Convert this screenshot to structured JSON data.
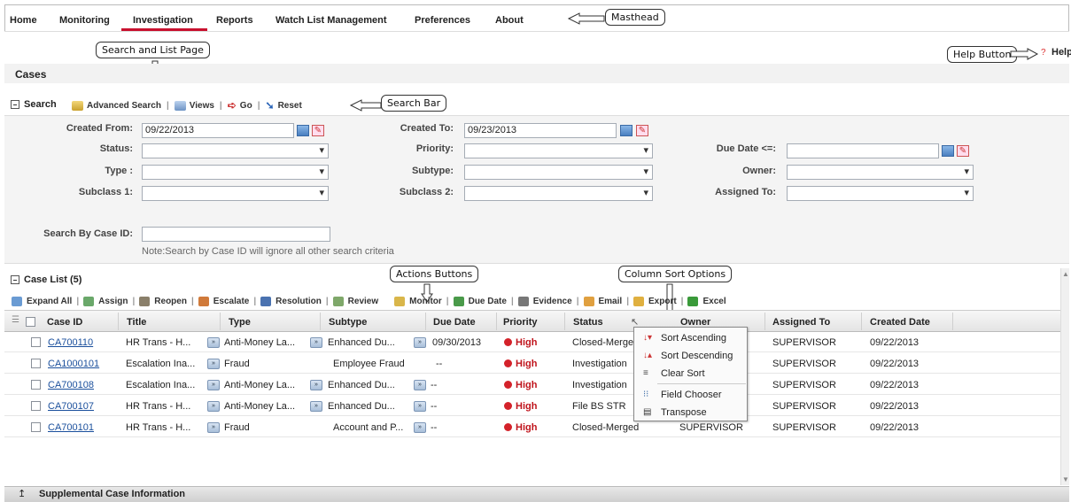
{
  "masthead": {
    "tabs": [
      "Home",
      "Monitoring",
      "Investigation",
      "Reports",
      "Watch List Management",
      "Preferences",
      "About"
    ],
    "active_tab": "Investigation"
  },
  "callouts": {
    "masthead": "Masthead",
    "search_list_page": "Search and List Page",
    "help_button": "Help Button",
    "search_bar": "Search Bar",
    "actions_buttons": "Actions Buttons",
    "column_sort_options": "Column Sort Options"
  },
  "page": {
    "title": "Cases",
    "help": "Help"
  },
  "search": {
    "title": "Search",
    "tools": {
      "advanced": "Advanced Search",
      "views": "Views",
      "go": "Go",
      "reset": "Reset"
    },
    "fields": {
      "created_from": {
        "label": "Created From:",
        "value": "09/22/2013"
      },
      "created_to": {
        "label": "Created To:",
        "value": "09/23/2013"
      },
      "status": {
        "label": "Status:",
        "value": ""
      },
      "priority": {
        "label": "Priority:",
        "value": ""
      },
      "due_date": {
        "label": "Due Date <=:",
        "value": ""
      },
      "type": {
        "label": "Type :",
        "value": ""
      },
      "subtype": {
        "label": "Subtype:",
        "value": ""
      },
      "owner": {
        "label": "Owner:",
        "value": ""
      },
      "subclass1": {
        "label": "Subclass 1:",
        "value": ""
      },
      "subclass2": {
        "label": "Subclass 2:",
        "value": ""
      },
      "assigned_to": {
        "label": "Assigned To:",
        "value": ""
      },
      "case_id": {
        "label": "Search By Case ID:",
        "value": ""
      }
    },
    "note": "Note:Search by Case ID will ignore all other search criteria"
  },
  "case_list": {
    "title": "Case List (5)",
    "actions": [
      "Expand All",
      "Assign",
      "Reopen",
      "Escalate",
      "Resolution",
      "Review",
      "Monitor",
      "Due Date",
      "Evidence",
      "Email",
      "Export",
      "Excel"
    ],
    "columns": [
      "Case ID",
      "Title",
      "Type",
      "Subtype",
      "Due Date",
      "Priority",
      "Status",
      "Owner",
      "Assigned To",
      "Created Date"
    ],
    "rows": [
      {
        "id": "CA700110",
        "title": "HR Trans - H...",
        "type": "Anti-Money La...",
        "subtype": "Enhanced Du...",
        "due": "09/30/2013",
        "priority": "High",
        "status": "Closed-Merge",
        "owner": "",
        "assigned": "SUPERVISOR",
        "created": "09/22/2013"
      },
      {
        "id": "CA1000101",
        "title": "Escalation Ina...",
        "type": "Fraud",
        "subtype": "Employee Fraud",
        "due": "--",
        "priority": "High",
        "status": "Investigation",
        "owner": "",
        "assigned": "SUPERVISOR",
        "created": "09/22/2013"
      },
      {
        "id": "CA700108",
        "title": "Escalation Ina...",
        "type": "Anti-Money La...",
        "subtype": "Enhanced Du...",
        "due": "--",
        "priority": "High",
        "status": "Investigation",
        "owner": "",
        "assigned": "SUPERVISOR",
        "created": "09/22/2013"
      },
      {
        "id": "CA700107",
        "title": "HR Trans - H...",
        "type": "Anti-Money La...",
        "subtype": "Enhanced Du...",
        "due": "--",
        "priority": "High",
        "status": "File BS STR",
        "owner": "",
        "assigned": "SUPERVISOR",
        "created": "09/22/2013"
      },
      {
        "id": "CA700101",
        "title": "HR Trans - H...",
        "type": "Fraud",
        "subtype": "Account and P...",
        "due": "--",
        "priority": "High",
        "status": "Closed-Merged",
        "owner": "SUPERVISOR",
        "assigned": "SUPERVISOR",
        "created": "09/22/2013"
      }
    ]
  },
  "context_menu": {
    "items": [
      "Sort Ascending",
      "Sort Descending",
      "Clear Sort",
      "Field Chooser",
      "Transpose"
    ]
  },
  "supplemental": {
    "title": "Supplemental Case Information"
  },
  "colors": {
    "active_tab_underline": "#c8102e",
    "priority_high": "#c0141c",
    "link": "#1a4f9c"
  }
}
